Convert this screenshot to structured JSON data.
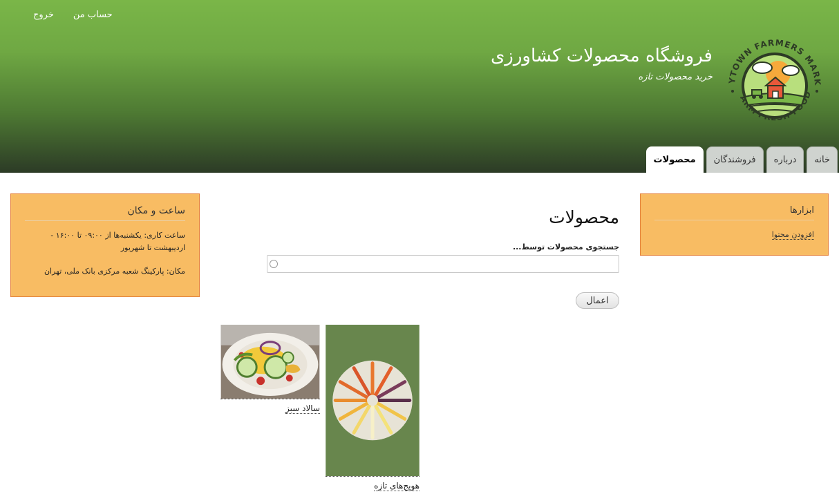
{
  "header": {
    "site_name": "فروشگاه محصولات کشاورزی",
    "slogan": "خرید محصولات تازه",
    "logo": {
      "top_text": "ANYTOWN FARMERS MARKET",
      "bottom_text": "FARM FRESH FOOD"
    },
    "secondary_menu": [
      {
        "label": "حساب من"
      },
      {
        "label": "خروج"
      }
    ],
    "tabs": [
      {
        "label": "خانه",
        "active": false
      },
      {
        "label": "درباره",
        "active": false
      },
      {
        "label": "فروشندگان",
        "active": false
      },
      {
        "label": "محصولات",
        "active": true
      }
    ]
  },
  "tools_block": {
    "title": "ابزارها",
    "link": "افزودن محتوا"
  },
  "hours_block": {
    "title": "ساعت و مکان",
    "hours": "ساعت کاری: یکشنبه‌ها از ۰۹:۰۰ تا ۱۶:۰۰ - اردیبهشت تا شهریور",
    "location": "مکان: پارکینگ شعبه مرکزی بانک ملی، تهران"
  },
  "main": {
    "title": "محصولات",
    "search_label": "جستجوی محصولات توسط...",
    "search_value": "",
    "apply_label": "اعمال"
  },
  "products": [
    {
      "name": "هویج‌های تازه",
      "icon": "carrots-image"
    },
    {
      "name": "سالاد سبز",
      "icon": "salad-image"
    }
  ],
  "colors": {
    "header_top": "#7ab648",
    "header_bottom": "#2c3b26",
    "sidebar_bg": "#f8bc63",
    "sidebar_border": "#e4803a"
  }
}
